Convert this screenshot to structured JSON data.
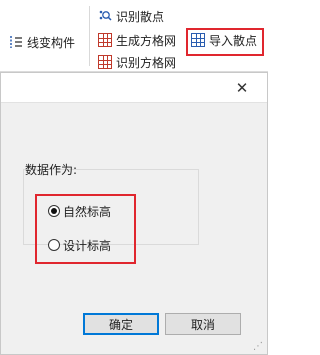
{
  "ribbon": {
    "line_component_label": "线变构件",
    "identify_scatter_label": "识别散点",
    "generate_grid_label": "生成方格网",
    "import_scatter_label": "导入散点",
    "identify_grid_label": "识别方格网",
    "highlight_color": "#e0262e"
  },
  "dialog": {
    "close_glyph": "✕",
    "group_label": "数据作为:",
    "option_natural": "自然标高",
    "option_design": "设计标高",
    "selected_option": "自然标高",
    "ok_label": "确定",
    "cancel_label": "取消"
  }
}
